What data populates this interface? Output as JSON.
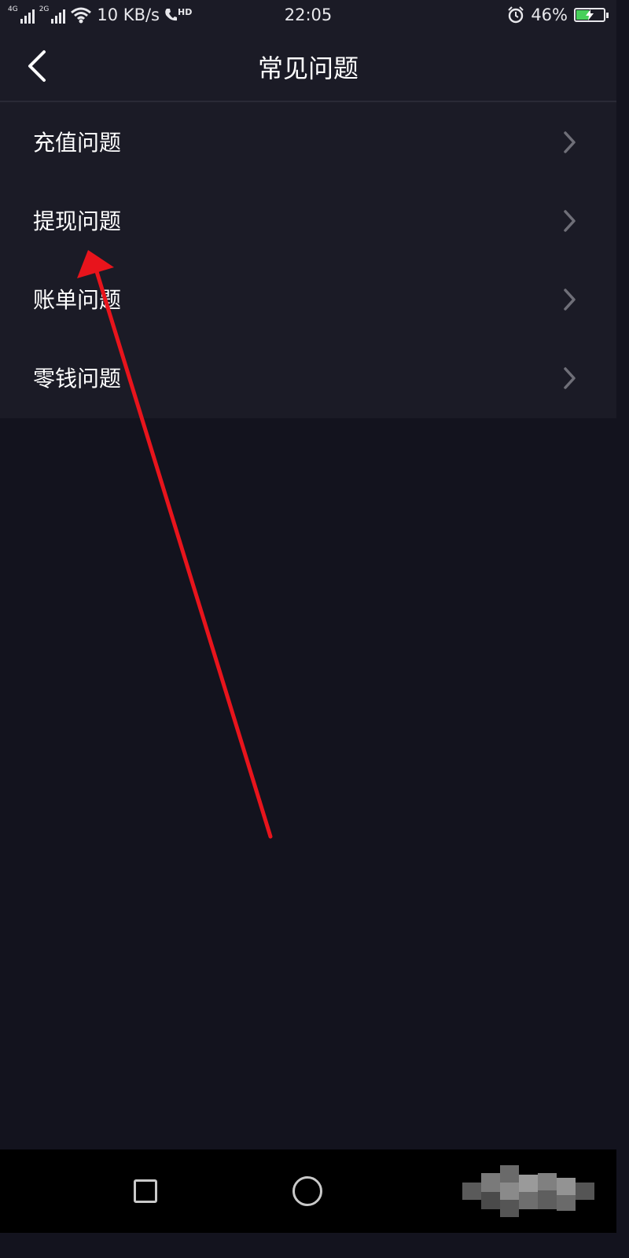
{
  "status_bar": {
    "signal_1": "4G",
    "signal_2": "2G",
    "net_speed": "10 KB/s",
    "hd_badge": "HD",
    "time": "22:05",
    "battery_percent": "46%",
    "battery_level": 0.46,
    "icons": [
      "signal-icon",
      "wifi-icon",
      "hd-call-icon",
      "alarm-icon",
      "battery-icon"
    ]
  },
  "header": {
    "title": "常见问题",
    "back_icon": "chevron-left-icon"
  },
  "faq": {
    "items": [
      {
        "label": "充值问题"
      },
      {
        "label": "提现问题"
      },
      {
        "label": "账单问题"
      },
      {
        "label": "零钱问题"
      }
    ],
    "chevron_icon": "chevron-right-icon"
  },
  "system_nav": {
    "icons": [
      "square-recent-apps-icon",
      "circle-home-icon",
      "pixelated-back-icon"
    ]
  },
  "colors": {
    "background": "#13131e",
    "surface": "#1b1b26",
    "text": "#ffffff",
    "chevron": "#6f6f78",
    "battery": "#47d05a",
    "annotation": "#e8141c"
  }
}
